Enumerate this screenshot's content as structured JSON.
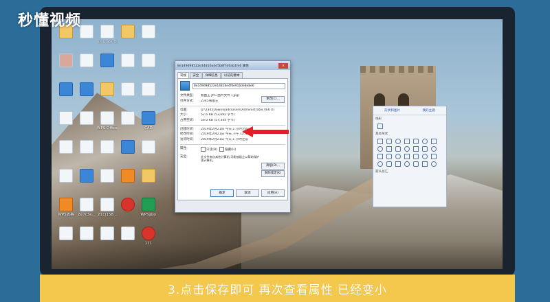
{
  "logo": {
    "text": "秒懂视频"
  },
  "desktop_icons": [
    {
      "label": "",
      "kind": "folder"
    },
    {
      "label": "",
      "kind": "doc"
    },
    {
      "label": "emulate 0...",
      "kind": "doc"
    },
    {
      "label": "",
      "kind": "folder"
    },
    {
      "label": "",
      "kind": "doc"
    },
    {
      "label": "",
      "kind": "photo"
    },
    {
      "label": "",
      "kind": "doc"
    },
    {
      "label": "",
      "kind": "blue"
    },
    {
      "label": "",
      "kind": "doc"
    },
    {
      "label": "",
      "kind": "doc"
    },
    {
      "label": "",
      "kind": "blue"
    },
    {
      "label": "",
      "kind": "blue"
    },
    {
      "label": "",
      "kind": "folder"
    },
    {
      "label": "",
      "kind": "doc"
    },
    {
      "label": "",
      "kind": "doc"
    },
    {
      "label": "",
      "kind": "doc"
    },
    {
      "label": "",
      "kind": "doc"
    },
    {
      "label": "WPS Office",
      "kind": "doc"
    },
    {
      "label": "",
      "kind": "doc"
    },
    {
      "label": "CAD",
      "kind": "blue"
    },
    {
      "label": "",
      "kind": "doc"
    },
    {
      "label": "",
      "kind": "doc"
    },
    {
      "label": "",
      "kind": "doc"
    },
    {
      "label": "",
      "kind": "blue"
    },
    {
      "label": "",
      "kind": "doc"
    },
    {
      "label": "",
      "kind": "doc"
    },
    {
      "label": "",
      "kind": "blue"
    },
    {
      "label": "",
      "kind": "doc"
    },
    {
      "label": "",
      "kind": "orange"
    },
    {
      "label": "",
      "kind": "folder"
    },
    {
      "label": "WPS表格",
      "kind": "orange"
    },
    {
      "label": "Ze7c3e...",
      "kind": "doc"
    },
    {
      "label": "21日158...",
      "kind": "doc"
    },
    {
      "label": "",
      "kind": "red"
    },
    {
      "label": "WPS演示",
      "kind": "green"
    },
    {
      "label": "",
      "kind": "doc"
    },
    {
      "label": "",
      "kind": "doc"
    },
    {
      "label": "",
      "kind": "doc"
    },
    {
      "label": "",
      "kind": "doc"
    },
    {
      "label": "111",
      "kind": "red"
    }
  ],
  "dialog": {
    "title": "8e149d98522e14816a4d5b8f7d6ab1fe6 属性",
    "close": "×",
    "tabs": [
      "常规",
      "安全",
      "详细信息",
      "以前的版本"
    ],
    "file_name": "8e149d98522e14816e4f0e91b0e8e8e6",
    "rows": [
      {
        "k": "文件类型:",
        "v": "看图王 JPG 图片文件 (.jpg)"
      },
      {
        "k": "打开方式:",
        "v": "2345看图王"
      }
    ],
    "change_button": "更改(C)...",
    "rows2": [
      {
        "k": "位置:",
        "v": "D:\\2345Downloads\\Users\\Administrator.VE6TIT"
      },
      {
        "k": "大小:",
        "v": "52.6 KB (53,692 字节)"
      },
      {
        "k": "占用空间:",
        "v": "56.0 KB (57,344 字节)"
      }
    ],
    "rows3": [
      {
        "k": "创建时间:",
        "v": "2019年2月21日 今天,1 小时之前"
      },
      {
        "k": "修改时间:",
        "v": "2019年2月21日 今天,下午 12:44:33"
      },
      {
        "k": "访问时间:",
        "v": "2019年2月21日 今天,1 小时之前"
      }
    ],
    "attr_label": "属性:",
    "readonly": "只读(R)",
    "hidden": "隐藏(H)",
    "advanced_button": "高级(D)...",
    "security_label": "安全:",
    "security_text": "此文件来自其他计算机,可能被阻止以帮助保护该计算机。",
    "unblock_button": "解除锁定(K)",
    "ok": "确定",
    "cancel": "取消",
    "apply": "应用(A)"
  },
  "shapes_panel": {
    "tabs": [
      "形状和图片",
      "我的主题"
    ],
    "sections": [
      "线形",
      "基本形状",
      "箭头总汇"
    ]
  },
  "caption": "3.点击保存即可 再次查看属性 已经变小",
  "colors": {
    "background": "#2b6c99",
    "caption_bar": "#f3c84d",
    "arrow": "#e21e26"
  }
}
